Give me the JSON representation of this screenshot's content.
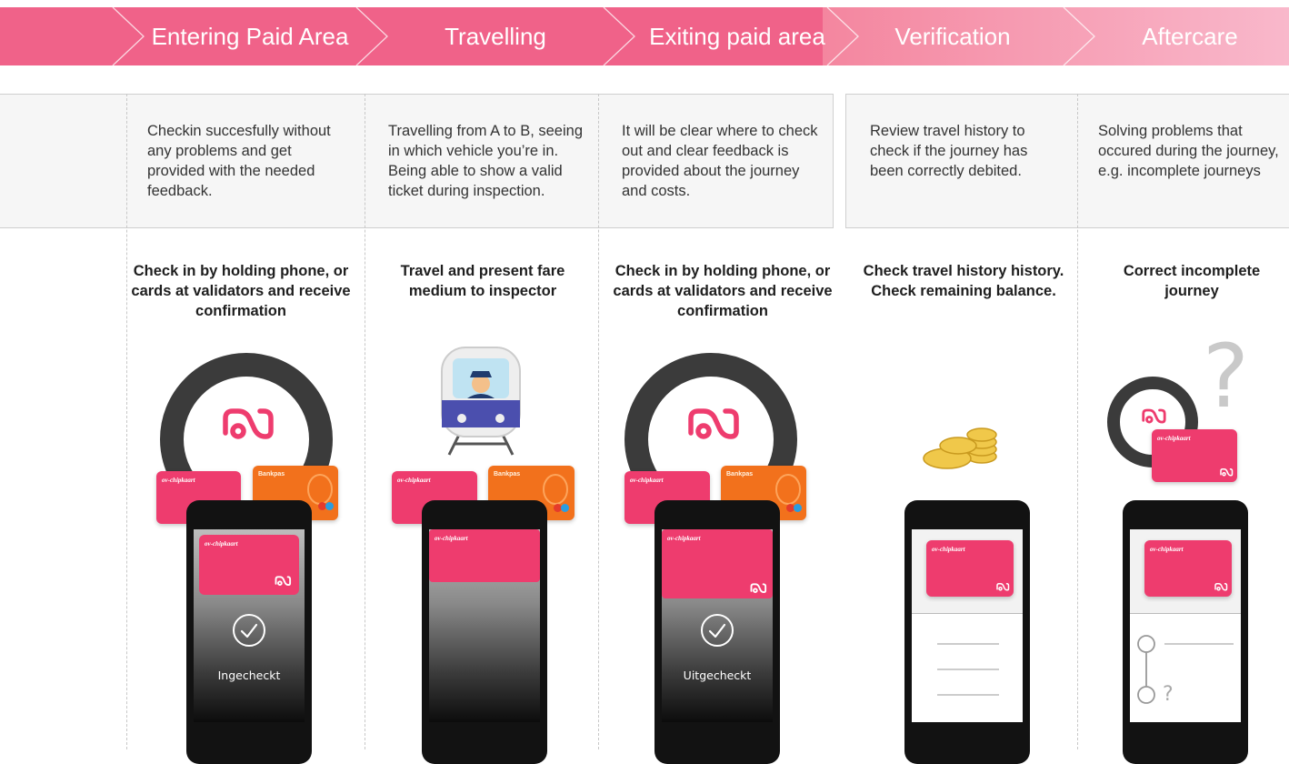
{
  "stages": [
    {
      "label": "Entering Paid Area"
    },
    {
      "label": "Travelling"
    },
    {
      "label": "Exiting paid area"
    },
    {
      "label": "Verification"
    },
    {
      "label": "Aftercare"
    }
  ],
  "descriptions": [
    "Checkin succesfully without any problems and get provided with the needed feedback.",
    "Travelling from A to B, seeing in which vehicle you’re in. Being able to show a valid ticket during inspection.",
    "It will be clear where to check out and clear feedback is provided about the journey and costs.",
    "Review travel history to check if the journey has been correctly debited.",
    "Solving problems that occured during the journey, e.g. incomplete journeys"
  ],
  "actions": [
    "Check in by holding phone, or cards at validators and receive confirmation",
    "Travel and present fare medium to inspector",
    "Check in by holding phone, or cards at validators and receive confirmation",
    "Check travel history history. Check remaining balance.",
    "Correct incomplete journey"
  ],
  "cards": {
    "ov_brand": "ov-chipkaart",
    "bank_brand": "Bankpas"
  },
  "phones": {
    "checkin_status": "Ingecheckt",
    "checkout_status": "Uitgecheckt",
    "unknown_stop": "?"
  },
  "icons": [
    "ov-logo-icon",
    "checkmark-icon",
    "train-conductor-icon",
    "coins-icon",
    "question-mark-icon",
    "history-list-icon",
    "journey-route-icon"
  ],
  "colors": {
    "banner_pink": "#f06289",
    "banner_light": "#f8aac2",
    "ov_pink": "#ee3c6e",
    "bank_orange": "#f2711c",
    "ring_dark": "#3b3b3b",
    "coin_gold": "#f0c84a"
  }
}
